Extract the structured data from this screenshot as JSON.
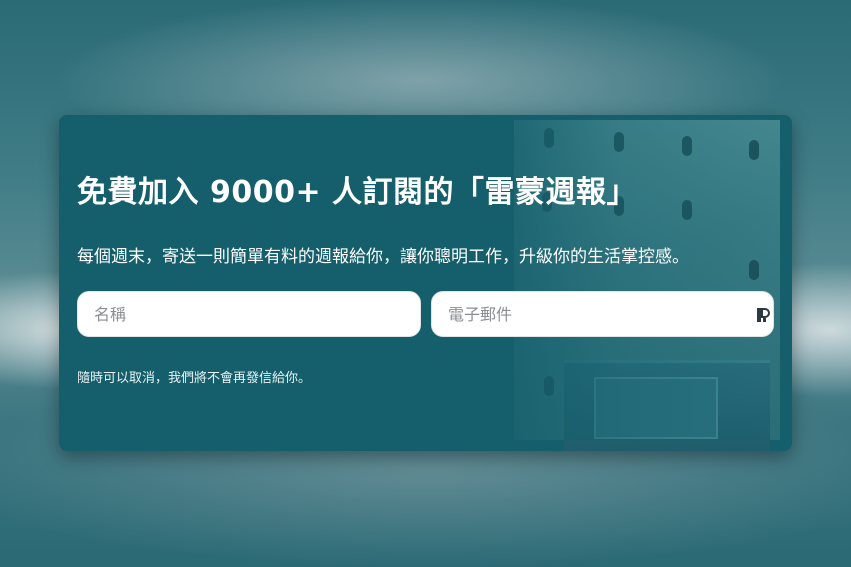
{
  "signup": {
    "headline": "免費加入 9000+ 人訂閱的「雷蒙週報」",
    "subtitle": "每個週末，寄送一則簡單有料的週報給你，讓你聰明工作，升級你的生活掌控感。",
    "name_placeholder": "名稱",
    "email_placeholder": "電子郵件",
    "unsubscribe_note": "隨時可以取消，我們將不會再發信給你。",
    "email_field_icon": "password-manager-icon"
  },
  "colors": {
    "card_background": "#155f6c",
    "text": "#ffffff",
    "input_background": "#ffffff"
  }
}
